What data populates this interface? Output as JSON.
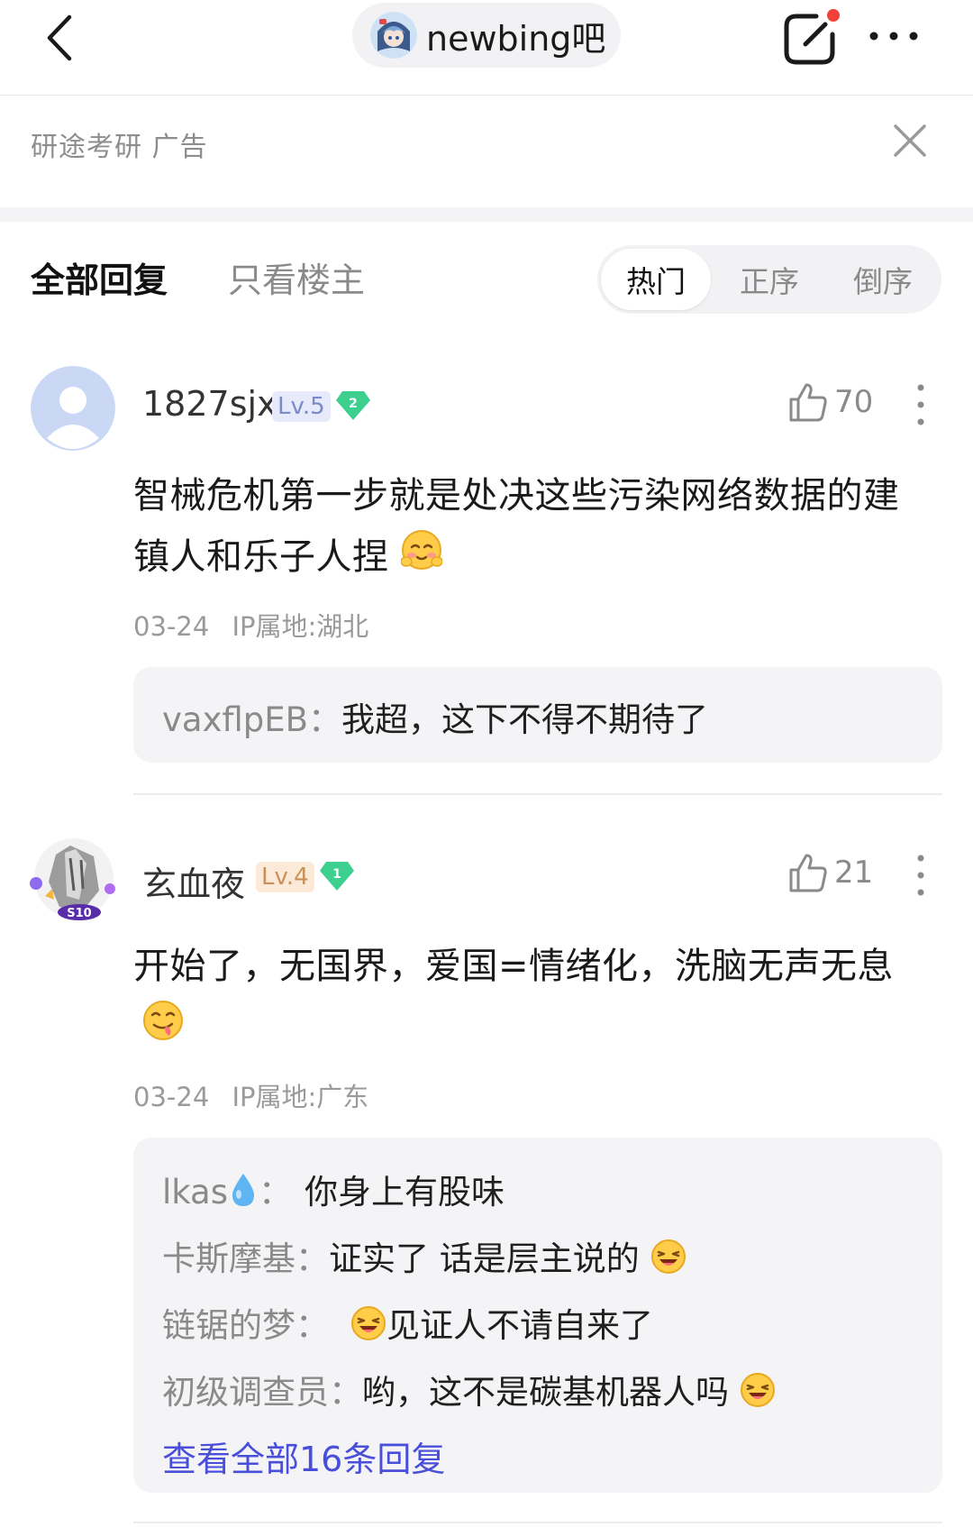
{
  "header": {
    "forum_name": "newbing吧"
  },
  "ad": {
    "text": "研途考研  广告"
  },
  "tabs": {
    "all": "全部回复",
    "op_only": "只看楼主",
    "sort": [
      "热门",
      "正序",
      "倒序"
    ],
    "active_sort": "热门"
  },
  "comments": [
    {
      "username": "1827sjx",
      "level": "Lv.5",
      "gem_level": "2",
      "likes": "70",
      "content_line1": "智械危机第一步就是处决这些污染网络数据的建",
      "content_line2": "镇人和乐子人捏",
      "date": "03-24",
      "ip": "IP属地:湖北",
      "replies": [
        {
          "name": "vaxflpEB：",
          "text": "我超，这下不得不期待了"
        }
      ]
    },
    {
      "username": "玄血夜",
      "level": "Lv.4",
      "gem_level": "1",
      "likes": "21",
      "content_line1": "开始了，无国界，爱国=情绪化，洗脑无声无息",
      "date": "03-24",
      "ip": "IP属地:广东",
      "replies": [
        {
          "name": "lkas",
          "name_suffix": "：",
          "text": "你身上有股味"
        },
        {
          "name": "卡斯摩基：",
          "text": "证实了 话是层主说的"
        },
        {
          "name": "链锯的梦：",
          "text": "见证人不请自来了"
        },
        {
          "name": "初级调查员：",
          "text": "哟，这不是碳基机器人吗"
        }
      ],
      "view_all": "查看全部16条回复"
    }
  ],
  "colors": {
    "accent": "#4a4fd9",
    "gem": "#3dcf8e",
    "lv5_bg": "#e6eafa",
    "lv5_text": "#7b8bc9",
    "lv4_bg": "#fbead8",
    "lv4_text": "#c9915a",
    "notification_dot": "#f2413a"
  },
  "icons": [
    "back-chevron-icon",
    "compose-icon",
    "more-icon",
    "close-icon",
    "thumbs-up-icon",
    "kebab-icon",
    "gem-icon",
    "water-drop-icon",
    "blush-emoji-icon",
    "yum-emoji-icon",
    "laugh-emoji-icon"
  ]
}
